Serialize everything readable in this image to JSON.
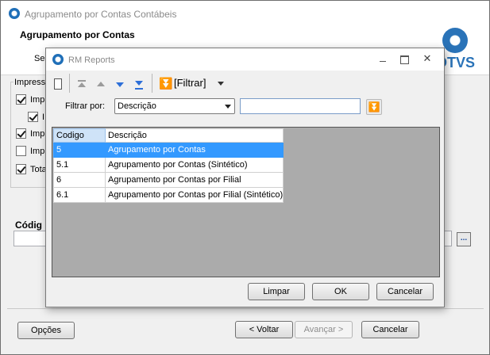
{
  "main_window": {
    "title": "Agrupamento por Contas Contábeis",
    "header_title": "Agrupamento por Contas",
    "header_sub_partial": "Se",
    "logo_text": "OTVS",
    "group_legend": "Impressã",
    "checkboxes": [
      {
        "label": "Impr",
        "checked": true
      },
      {
        "label": "I",
        "checked": true
      },
      {
        "label": "Imp",
        "checked": true
      },
      {
        "label": "Imp",
        "checked": false
      },
      {
        "label": "Tota",
        "checked": true
      }
    ],
    "codigo_label": "Códig",
    "dots_label": "...",
    "buttons": {
      "opcoes": "Opções",
      "voltar": "< Voltar",
      "avancar": "Avançar >",
      "cancelar": "Cancelar"
    }
  },
  "dialog": {
    "title": "RM Reports",
    "toolbar": {
      "filter_label": "[Filtrar]"
    },
    "filter": {
      "label": "Filtrar por:",
      "selected": "Descrição",
      "search_value": ""
    },
    "grid": {
      "columns": [
        "Codigo",
        "Descrição"
      ],
      "rows": [
        {
          "codigo": "5",
          "descricao": "Agrupamento por Contas",
          "selected": true
        },
        {
          "codigo": "5.1",
          "descricao": "Agrupamento por Contas (Sintético)",
          "selected": false
        },
        {
          "codigo": "6",
          "descricao": "Agrupamento por Contas por Filial",
          "selected": false
        },
        {
          "codigo": "6.1",
          "descricao": "Agrupamento por Contas por Filial (Sintético)",
          "selected": false
        }
      ]
    },
    "buttons": {
      "limpar": "Limpar",
      "ok": "OK",
      "cancelar": "Cancelar"
    }
  },
  "colors": {
    "selection": "#3399ff",
    "brand": "#2a73b8",
    "grid_background": "#ababab"
  }
}
